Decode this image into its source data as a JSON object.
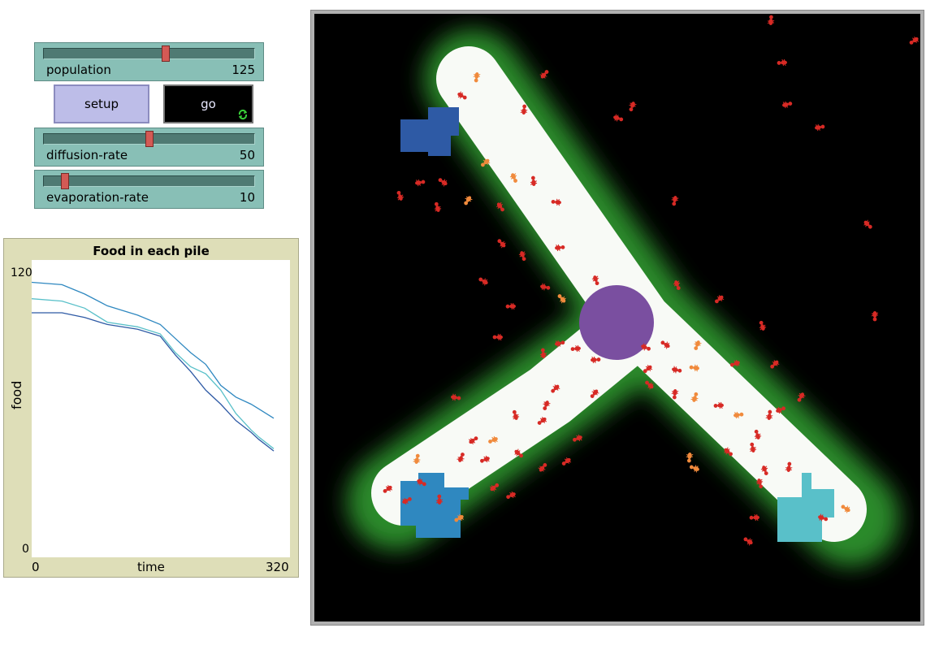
{
  "sliders": [
    {
      "name": "population",
      "value": "125",
      "fraction": 0.58
    },
    {
      "name": "diffusion-rate",
      "value": "50",
      "fraction": 0.5
    },
    {
      "name": "evaporation-rate",
      "value": "10",
      "fraction": 0.1
    }
  ],
  "buttons": {
    "setup_label": "setup",
    "go_label": "go"
  },
  "plot": {
    "title": "Food in each pile",
    "ylabel": "food",
    "xlabel": "time",
    "y_max": "120",
    "y_min": "0",
    "x_min": "0",
    "x_max": "320"
  },
  "chart_data": {
    "type": "line",
    "title": "Food in each pile",
    "xlabel": "time",
    "ylabel": "food",
    "xlim": [
      0,
      320
    ],
    "ylim": [
      0,
      120
    ],
    "series": [
      {
        "color": "#2f88c0",
        "x": [
          0,
          40,
          70,
          100,
          140,
          170,
          190,
          210,
          230,
          250,
          270,
          290,
          300,
          320
        ],
        "y": [
          116,
          115,
          111,
          106,
          102,
          98,
          92,
          86,
          81,
          72,
          67,
          64,
          62,
          58
        ]
      },
      {
        "color": "#59c0c9",
        "x": [
          0,
          40,
          70,
          100,
          140,
          170,
          190,
          210,
          230,
          250,
          270,
          290,
          300,
          320
        ],
        "y": [
          109,
          108,
          105,
          99,
          97,
          94,
          86,
          80,
          77,
          70,
          60,
          53,
          50,
          45
        ]
      },
      {
        "color": "#2e5aa5",
        "x": [
          0,
          40,
          70,
          100,
          140,
          170,
          190,
          210,
          230,
          250,
          270,
          290,
          300,
          320
        ],
        "y": [
          103,
          103,
          101,
          98,
          96,
          93,
          85,
          78,
          70,
          64,
          57,
          52,
          49,
          44
        ]
      }
    ]
  },
  "world": {
    "colors": {
      "background": "#000000",
      "chemical": "#2c8a2c",
      "trail": "#f8faf6",
      "nest": "#7a4fa0",
      "food_pile_1": "#2e5aa5",
      "food_pile_2": "#2f88c0",
      "food_pile_3": "#59c0c9",
      "ant_searching": "#d72a25",
      "ant_carrying": "#f08a3c"
    }
  }
}
